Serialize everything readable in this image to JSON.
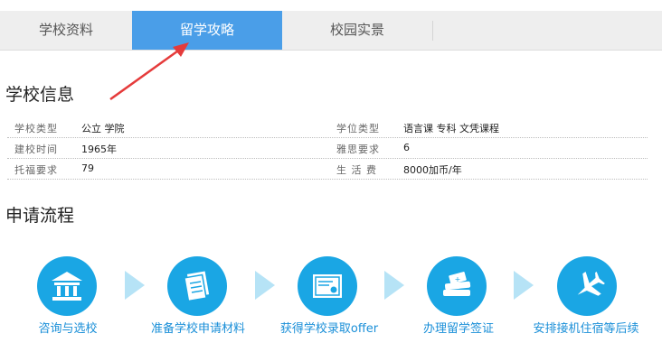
{
  "tabs": [
    {
      "label": "学校资料",
      "active": false
    },
    {
      "label": "留学攻略",
      "active": true
    },
    {
      "label": "校园实景",
      "active": false
    }
  ],
  "school_info": {
    "title": "学校信息",
    "rows": [
      {
        "left_label": "学校类型",
        "left_value": "公立 学院",
        "right_label": "学位类型",
        "right_value": "语言课 专科 文凭课程"
      },
      {
        "left_label": "建校时间",
        "left_value": "1965年",
        "right_label": "雅思要求",
        "right_value": "6"
      },
      {
        "left_label": "托福要求",
        "left_value": "79",
        "right_label": "生 活 费",
        "right_value": "8000加币/年"
      }
    ]
  },
  "process": {
    "title": "申请流程",
    "steps": [
      {
        "label": "咨询与选校",
        "icon": "school-building-icon"
      },
      {
        "label": "准备学校申请材料",
        "icon": "documents-icon"
      },
      {
        "label": "获得学校录取offer",
        "icon": "certificate-icon"
      },
      {
        "label": "办理留学签证",
        "icon": "passport-books-icon"
      },
      {
        "label": "安排接机住宿等后续",
        "icon": "airplane-icon"
      }
    ]
  },
  "colors": {
    "accent": "#4a9ee8",
    "circle": "#1aa6e4",
    "arrow_annotation": "#e53b3b"
  }
}
